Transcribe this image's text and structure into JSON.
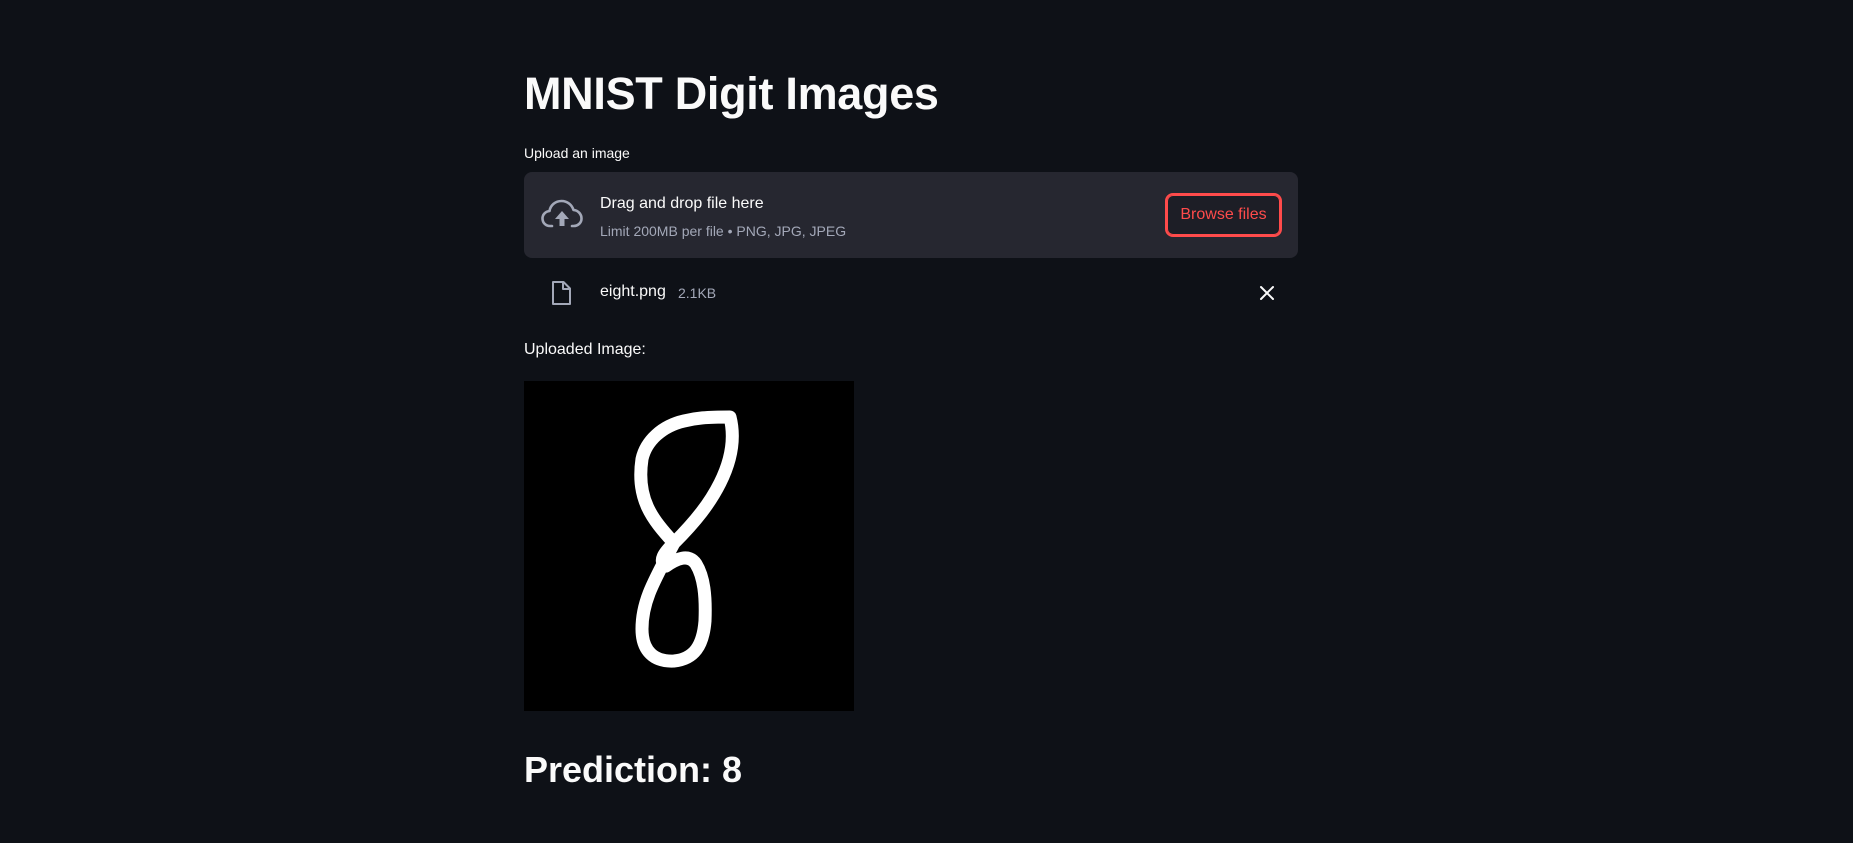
{
  "page": {
    "title": "MNIST Digit Images"
  },
  "uploader": {
    "label": "Upload an image",
    "drop_title": "Drag and drop file here",
    "drop_subtitle": "Limit 200MB per file • PNG, JPG, JPEG",
    "browse_label": "Browse files",
    "icons": {
      "upload": "cloud-upload-icon",
      "file": "file-icon",
      "remove": "close-icon"
    }
  },
  "uploaded_file": {
    "name": "eight.png",
    "size": "2.1KB"
  },
  "preview": {
    "label": "Uploaded Image:"
  },
  "result": {
    "prediction_text": "Prediction: 8"
  },
  "colors": {
    "background": "#0e1117",
    "panel": "#262730",
    "accent": "#ff4b4b",
    "text": "#fafafa",
    "muted_text": "#a3a8b8"
  }
}
